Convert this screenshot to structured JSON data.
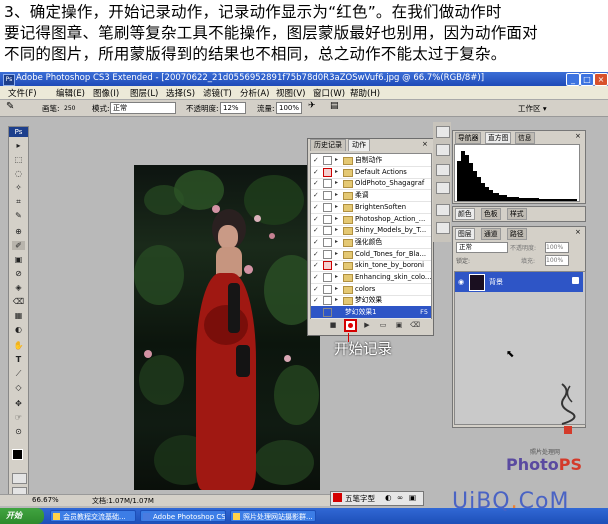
{
  "caption": {
    "line1": "3、确定操作，开始记录动作，记录动作显示为“红色”。在我们做动作时",
    "line2": "要记得图章、笔刷等复杂工具不能操作，图层蒙版最好也别用，因为动作面对",
    "line3": "不同的图片，所用蒙版得到的结果也不相同，总之动作不能太过于复杂。"
  },
  "window": {
    "title": "Adobe Photoshop CS3 Extended - [20070622_21d0556952891f75b78d0R3aZOSwVuf6.jpg @ 66.7%(RGB/8#)]",
    "app_icon": "Ps",
    "min": "_",
    "max": "□",
    "close": "×"
  },
  "menu": {
    "items": [
      "文件(F)",
      "编辑(E)",
      "图像(I)",
      "图层(L)",
      "选择(S)",
      "滤镜(T)",
      "分析(A)",
      "视图(V)",
      "窗口(W)",
      "帮助(H)"
    ],
    "workspace": "工作区 ▾"
  },
  "options": {
    "brush_label": "画笔:",
    "brush_size": "250",
    "mode_label": "模式:",
    "mode_value": "正常",
    "opacity_label": "不透明度:",
    "opacity_value": "12%",
    "flow_label": "流量:",
    "flow_value": "100%"
  },
  "toolbox": {
    "header": "Ps",
    "tools": [
      "▸",
      "⬚",
      "◌",
      "✧",
      "⌗",
      "✎",
      "⊕",
      "✐",
      "▣",
      "⊘",
      "◈",
      "⌫",
      "▦",
      "◐",
      "✋",
      "T",
      "⟋",
      "◇",
      "✥",
      "☞",
      "⊙"
    ]
  },
  "actions_panel": {
    "tabs": [
      "历史记录",
      "动作"
    ],
    "close": "×",
    "rows": [
      {
        "check": "✓",
        "dialog": "none",
        "folder": true,
        "name": "自制动作",
        "selected": false
      },
      {
        "check": "✓",
        "dialog": "red",
        "folder": true,
        "name": "Default Actions",
        "selected": false
      },
      {
        "check": "✓",
        "dialog": "none",
        "folder": true,
        "name": "OldPhoto_Shagagraf",
        "selected": false
      },
      {
        "check": "✓",
        "dialog": "none",
        "folder": true,
        "name": "柔调",
        "selected": false
      },
      {
        "check": "✓",
        "dialog": "none",
        "folder": true,
        "name": "BrightenSoften",
        "selected": false
      },
      {
        "check": "✓",
        "dialog": "none",
        "folder": true,
        "name": "Photoshop_Action_...",
        "selected": false
      },
      {
        "check": "✓",
        "dialog": "none",
        "folder": true,
        "name": "Shiny_Models_by_T...",
        "selected": false
      },
      {
        "check": "✓",
        "dialog": "none",
        "folder": true,
        "name": "强化颜色",
        "selected": false
      },
      {
        "check": "✓",
        "dialog": "none",
        "folder": true,
        "name": "Cold_Tones_for_Bla...",
        "selected": false
      },
      {
        "check": "✓",
        "dialog": "red",
        "folder": true,
        "name": "skin_tone_by_boroni",
        "selected": false
      },
      {
        "check": "✓",
        "dialog": "none",
        "folder": true,
        "name": "Enhancing_skin_colo...",
        "selected": false
      },
      {
        "check": "✓",
        "dialog": "none",
        "folder": true,
        "name": "colors",
        "selected": false
      },
      {
        "check": "✓",
        "dialog": "none",
        "folder": true,
        "name": "梦幻效果",
        "selected": false
      },
      {
        "check": "",
        "dialog": "none",
        "folder": false,
        "name": "梦幻效果1",
        "selected": true,
        "fkey": "F5"
      }
    ],
    "buttons": [
      "■",
      "●",
      "▶",
      "▭",
      "▣",
      "⌫"
    ]
  },
  "annotation": {
    "record_label": "开始记录"
  },
  "navigator_panel": {
    "tabs": [
      "导航器",
      "直方图",
      "信息"
    ],
    "close": "×"
  },
  "color_panel": {
    "tabs": [
      "颜色",
      "色板",
      "样式"
    ]
  },
  "layers_panel": {
    "tabs": [
      "图层",
      "通道",
      "路径"
    ],
    "close": "×",
    "blend_mode": "正常",
    "opacity_label": "不透明度:",
    "opacity_value": "100%",
    "lock_label": "锁定:",
    "fill_label": "填充:",
    "fill_value": "100%",
    "layer_name": "背景"
  },
  "status": {
    "zoom": "66.67%",
    "doc": "文档:1.07M/1.07M"
  },
  "ime": {
    "label": "五笔字型",
    "icons": [
      "◐",
      "∞",
      "▣"
    ]
  },
  "taskbar": {
    "start": "开始",
    "tasks": [
      "会员教程交流基础...",
      "Adobe Photoshop CS...",
      "照片处理网站摄影群..."
    ]
  },
  "watermark": {
    "site_cn": "照片处理网",
    "photo": "Photo",
    "ps": "PS",
    "uibq_left": "UiBQ",
    "uibq_dot": ".",
    "uibq_right": "CoM"
  },
  "colors": {
    "selection": "#2e55c6",
    "record_red": "#d40000",
    "titlebar": "#2a5cc8",
    "panel_gray": "#d4d0c8"
  }
}
